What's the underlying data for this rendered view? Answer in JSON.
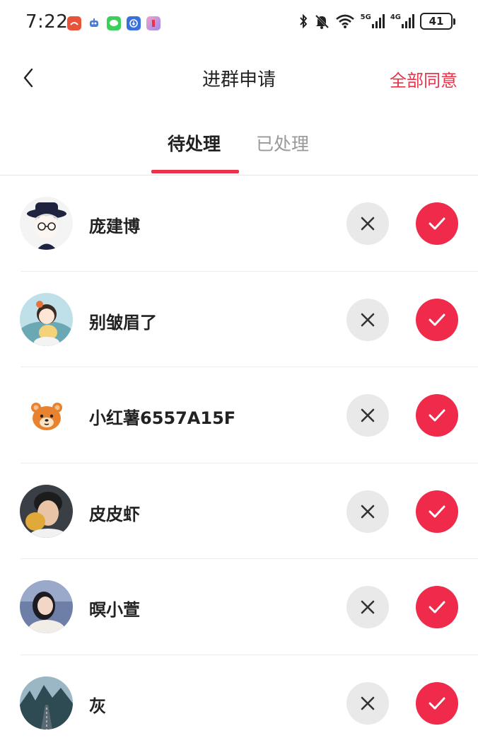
{
  "status_bar": {
    "time": "7:22",
    "signal_1": "5G",
    "signal_2": "4G",
    "battery": "41"
  },
  "header": {
    "title": "进群申请",
    "approve_all_label": "全部同意"
  },
  "tabs": [
    {
      "label": "待处理"
    },
    {
      "label": "已处理"
    }
  ],
  "requests": [
    {
      "name": "庞建博"
    },
    {
      "name": "别皱眉了"
    },
    {
      "name": "小红薯6557A15F"
    },
    {
      "name": "皮皮虾"
    },
    {
      "name": "暝小萱"
    },
    {
      "name": "灰"
    }
  ],
  "colors": {
    "accent": "#e8334a",
    "accept_bg": "#f02a4b",
    "reject_bg": "#e9e9e9"
  }
}
